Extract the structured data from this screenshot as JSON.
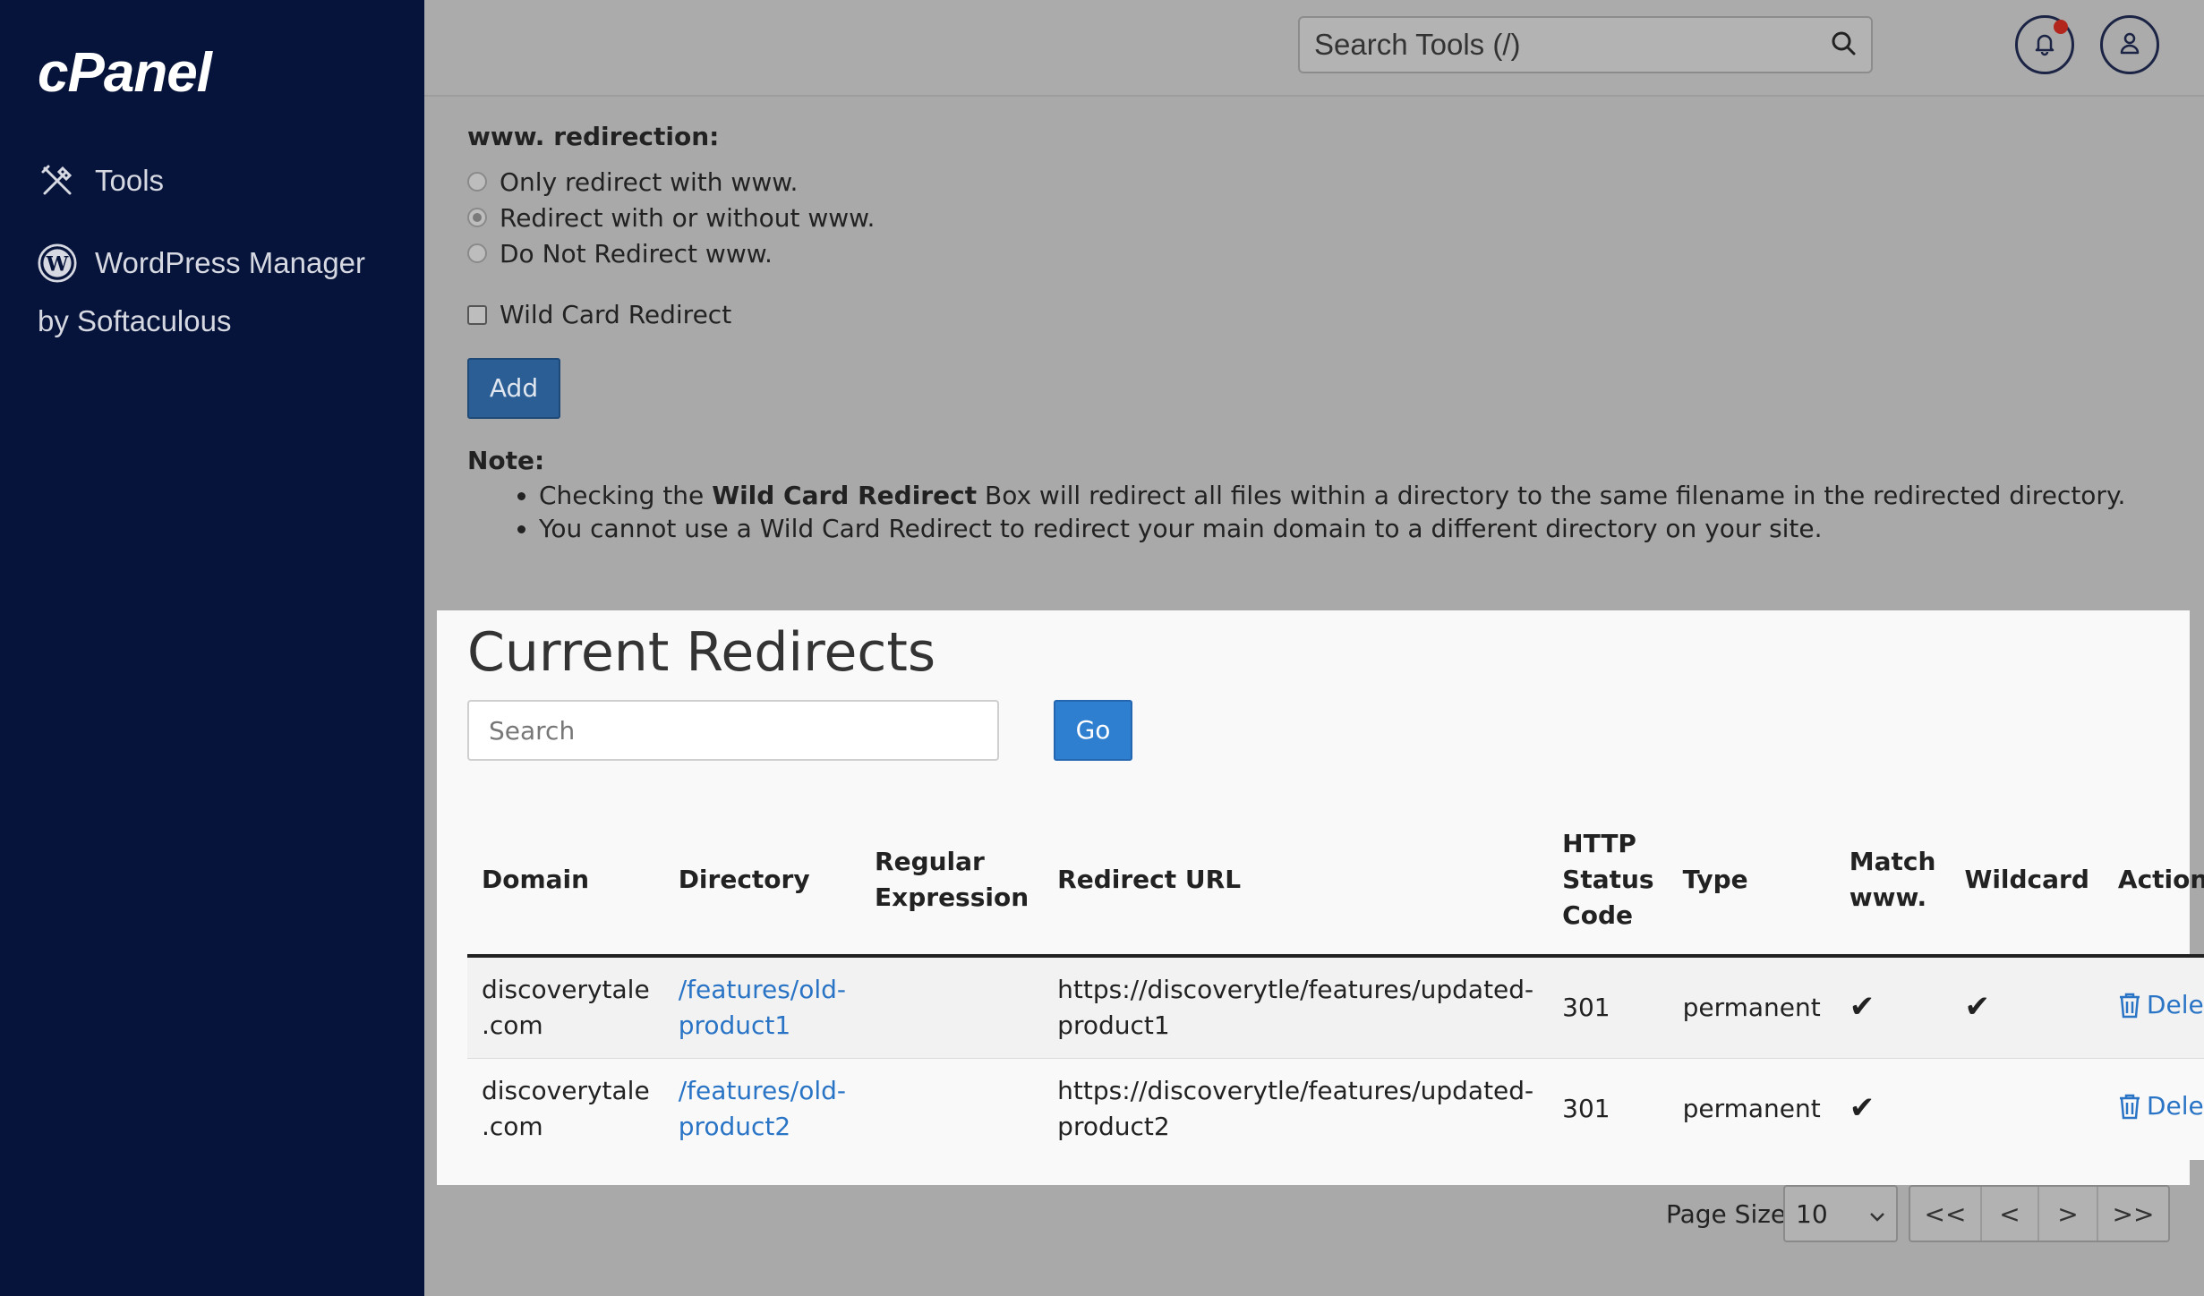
{
  "sidebar": {
    "logo": "cPanel",
    "items": [
      {
        "label": "Tools",
        "icon": "tools-icon"
      },
      {
        "label": "WordPress Manager",
        "sublabel": "by Softaculous",
        "icon": "wordpress-icon"
      }
    ]
  },
  "header": {
    "search_placeholder": "Search Tools (/)"
  },
  "form": {
    "www_label": "www. redirection:",
    "radio_options": [
      {
        "label": "Only redirect with www.",
        "checked": false
      },
      {
        "label": "Redirect with or without www.",
        "checked": true
      },
      {
        "label": "Do Not Redirect www.",
        "checked": false
      }
    ],
    "wildcard_label": "Wild Card Redirect",
    "add_label": "Add",
    "note_title": "Note:",
    "note_1_pre": "Checking the ",
    "note_1_bold": "Wild Card Redirect",
    "note_1_post": " Box will redirect all files within a directory to the same filename in the redirected directory.",
    "note_2": "You cannot use a Wild Card Redirect to redirect your main domain to a different directory on your site."
  },
  "redirects": {
    "title": "Current Redirects",
    "search_placeholder": "Search",
    "go_label": "Go",
    "headers": {
      "domain": "Domain",
      "directory": "Directory",
      "regex_1": "Regular",
      "regex_2": "Expression",
      "url": "Redirect URL",
      "status_1": "HTTP",
      "status_2": "Status",
      "status_3": "Code",
      "type": "Type",
      "match_1": "Match",
      "match_2": "www.",
      "wildcard": "Wildcard",
      "actions": "Actions"
    },
    "rows": [
      {
        "domain_1": "discoverytale",
        "domain_2": ".com",
        "directory_1": "/features/old-",
        "directory_2": "product1",
        "regex": "",
        "url_1": "https://discoverytle/features/updated-",
        "url_2": "product1",
        "status": "301",
        "type": "permanent",
        "match_www": "✔",
        "wildcard": "✔",
        "action": "Delete"
      },
      {
        "domain_1": "discoverytale",
        "domain_2": ".com",
        "directory_1": "/features/old-",
        "directory_2": "product2",
        "regex": "",
        "url_1": "https://discoverytle/features/updated-",
        "url_2": "product2",
        "status": "301",
        "type": "permanent",
        "match_www": "✔",
        "wildcard": "",
        "action": "Delete"
      }
    ]
  },
  "pagination": {
    "page_size_label": "Page Size",
    "page_size_value": "10",
    "first": "<<",
    "prev": "<",
    "next": ">",
    "last": ">>"
  }
}
